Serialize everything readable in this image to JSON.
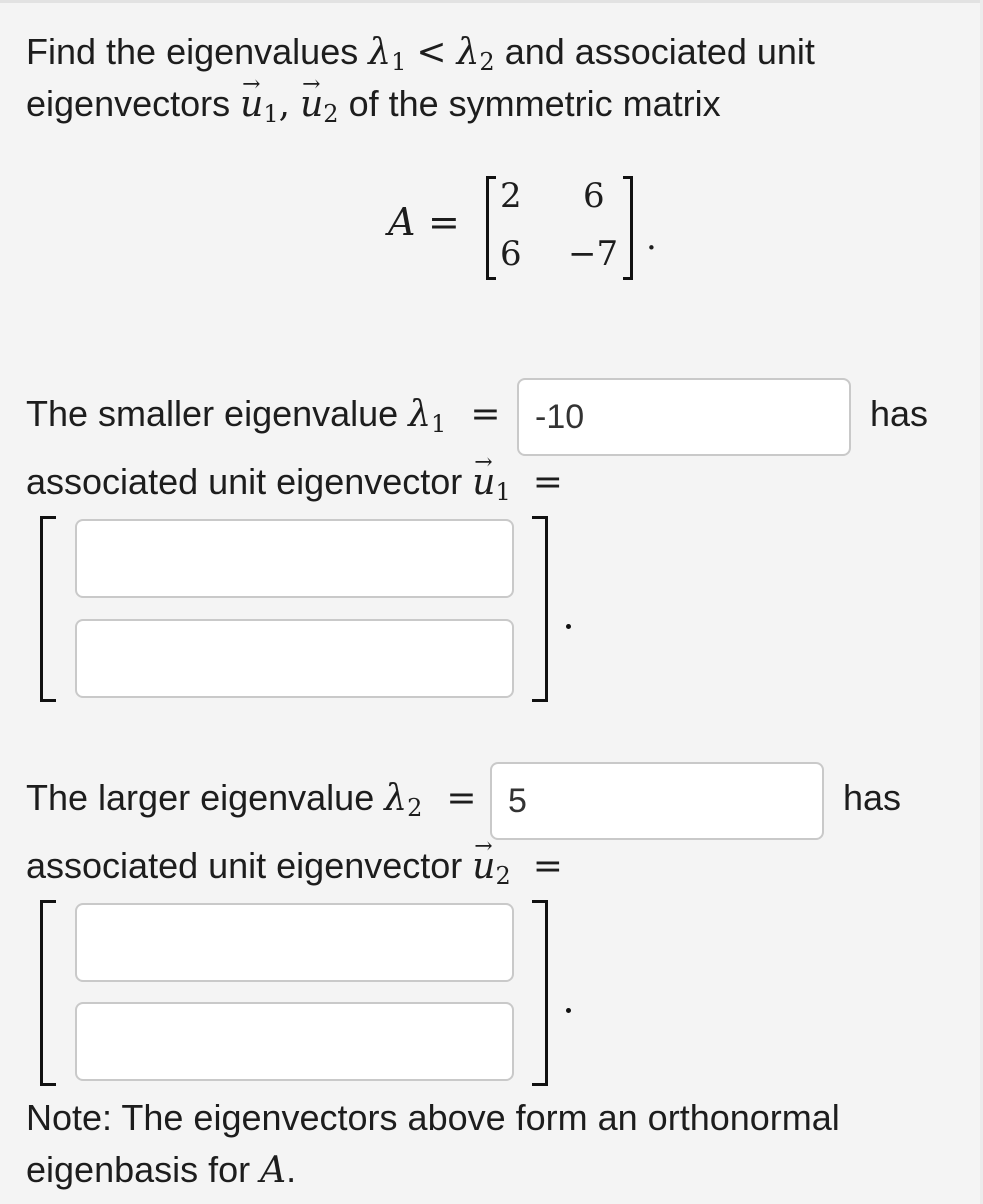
{
  "intro": {
    "line1_a": "Find the eigenvalues",
    "lambda1": "λ",
    "lambda1_sub": "1",
    "lt": "<",
    "lambda2": "λ",
    "lambda2_sub": "2",
    "line1_b": "and associated unit",
    "line2_a": "eigenvectors",
    "u": "u",
    "u1_sub": "1",
    "comma": ",",
    "u2_sub": "2",
    "line2_b": "of the symmetric matrix"
  },
  "matrix": {
    "name": "A",
    "eq": "=",
    "cells": [
      "2",
      "6",
      "6",
      "−7"
    ],
    "period": "."
  },
  "q1": {
    "text": "The smaller eigenvalue",
    "lambda": "λ",
    "sub": "1",
    "eq": "=",
    "value": "-10",
    "has": "has",
    "assoc": "associated unit eigenvector",
    "u": "u",
    "u_sub": "1",
    "u_eq": "=",
    "vec_top": "",
    "vec_bottom": "",
    "period": "."
  },
  "q2": {
    "text": "The larger eigenvalue",
    "lambda": "λ",
    "sub": "2",
    "eq": "=",
    "value": "5",
    "has": "has",
    "assoc": "associated unit eigenvector",
    "u": "u",
    "u_sub": "2",
    "u_eq": "=",
    "vec_top": "",
    "vec_bottom": "",
    "period": "."
  },
  "note": {
    "line1": "Note: The eigenvectors above form an orthonormal",
    "line2_a": "eigenbasis for",
    "A": "A",
    "line2_b": "."
  }
}
